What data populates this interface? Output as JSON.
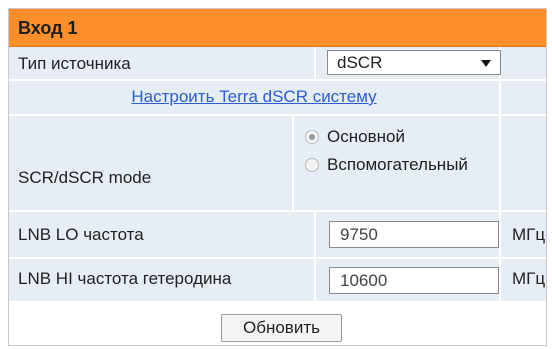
{
  "header": {
    "title": "Вход 1"
  },
  "source_type": {
    "label": "Тип источника",
    "selected": "dSCR"
  },
  "configure_link": {
    "text": "Настроить Terra dSCR систему"
  },
  "scr_mode": {
    "label": "SCR/dSCR mode",
    "options": [
      {
        "label": "Основной",
        "selected": true
      },
      {
        "label": "Вспомогательный",
        "selected": false
      }
    ]
  },
  "lnb_lo": {
    "label": "LNB LO частота",
    "value": "9750",
    "unit": "МГц"
  },
  "lnb_hi": {
    "label": "LNB HI частота гетеродина",
    "value": "10600",
    "unit": "МГц"
  },
  "actions": {
    "update_label": "Обновить"
  }
}
